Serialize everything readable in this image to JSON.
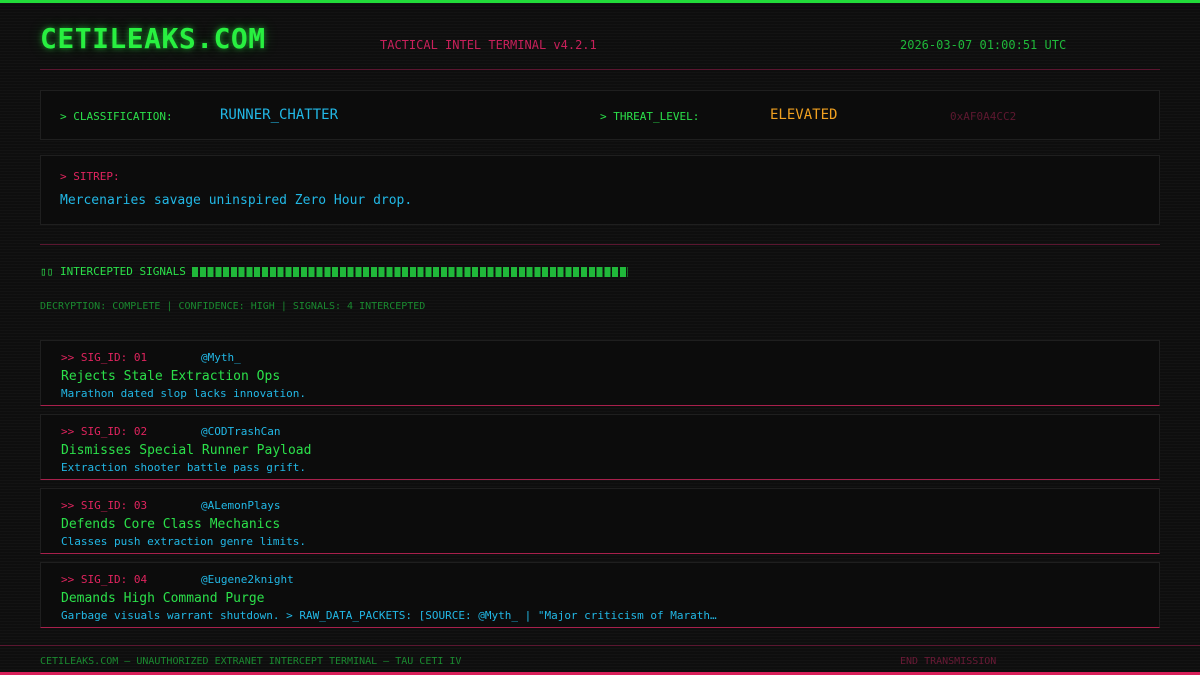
{
  "header": {
    "site_title": "CETILEAKS.COM",
    "terminal_version": "TACTICAL INTEL TERMINAL v4.2.1",
    "timestamp": "2026-03-07 01:00:51 UTC"
  },
  "classification": {
    "label": "> CLASSIFICATION:",
    "value": "RUNNER_CHATTER",
    "threat_label": "> THREAT_LEVEL:",
    "threat_value": "ELEVATED",
    "hex_code": "0xAF0A4CC2"
  },
  "sitrep": {
    "label": "> SITREP:",
    "text": "Mercenaries savage uninspired Zero Hour drop."
  },
  "intercepts": {
    "icon_glyph": "▯▯",
    "title": "INTERCEPTED SIGNALS",
    "status": "DECRYPTION: COMPLETE | CONFIDENCE: HIGH | SIGNALS: 4 INTERCEPTED"
  },
  "signals": [
    {
      "id": ">> SIG_ID: 01",
      "handle": "@Myth_",
      "title": "Rejects Stale Extraction Ops",
      "desc": "Marathon dated slop lacks innovation."
    },
    {
      "id": ">> SIG_ID: 02",
      "handle": "@CODTrashCan",
      "title": "Dismisses Special Runner Payload",
      "desc": "Extraction shooter battle pass grift."
    },
    {
      "id": ">> SIG_ID: 03",
      "handle": "@ALemonPlays",
      "title": "Defends Core Class Mechanics",
      "desc": "Classes push extraction genre limits."
    },
    {
      "id": ">> SIG_ID: 04",
      "handle": "@Eugene2knight",
      "title": "Demands High Command Purge",
      "desc": "Garbage visuals warrant shutdown. > RAW_DATA_PACKETS: [SOURCE: @Myth_ | \"Major criticism of Marath…"
    }
  ],
  "footer": {
    "text": "CETILEAKS.COM — UNAUTHORIZED EXTRANET INTERCEPT TERMINAL — TAU CETI IV",
    "end": "END TRANSMISSION"
  },
  "colors": {
    "background": "#0e0e0e",
    "accent_green": "#28f040",
    "accent_pink": "#e0245e",
    "accent_cyan": "#22b8e6",
    "accent_amber": "#f0a020"
  }
}
